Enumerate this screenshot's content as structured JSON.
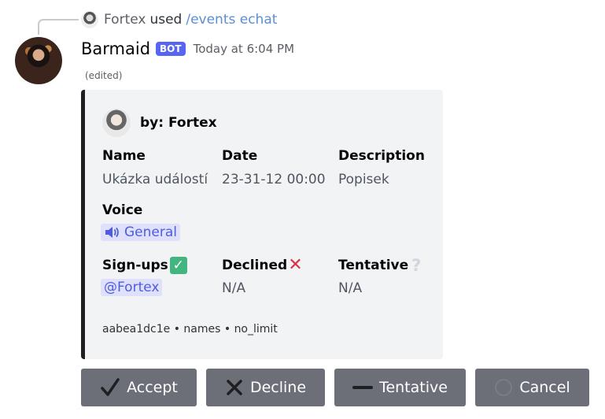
{
  "reply": {
    "user": "Fortex",
    "action": "used",
    "command": "/events echat"
  },
  "message": {
    "author": "Barmaid",
    "badge": "BOT",
    "timestamp": "Today at 6:04 PM",
    "edited": "(edited)"
  },
  "embed": {
    "author": "by: Fortex",
    "fields": {
      "name": {
        "label": "Name",
        "value": "Ukázka událostí"
      },
      "date": {
        "label": "Date",
        "value": "23-31-12 00:00"
      },
      "description": {
        "label": "Description",
        "value": "Popisek"
      },
      "voice": {
        "label": "Voice",
        "value": "General"
      },
      "signups": {
        "label": "Sign-ups",
        "value": "@Fortex"
      },
      "declined": {
        "label": "Declined",
        "value": "N/A"
      },
      "tentative": {
        "label": "Tentative",
        "value": "N/A"
      }
    },
    "footer": "aabea1dc1e • names • no_limit",
    "accent_color": "#1e1f22"
  },
  "buttons": {
    "accept": "Accept",
    "decline": "Decline",
    "tentative": "Tentative",
    "cancel": "Cancel"
  },
  "colors": {
    "blurple": "#5865f2",
    "button_bg": "#6d6f78",
    "link": "#5a8fd4"
  }
}
